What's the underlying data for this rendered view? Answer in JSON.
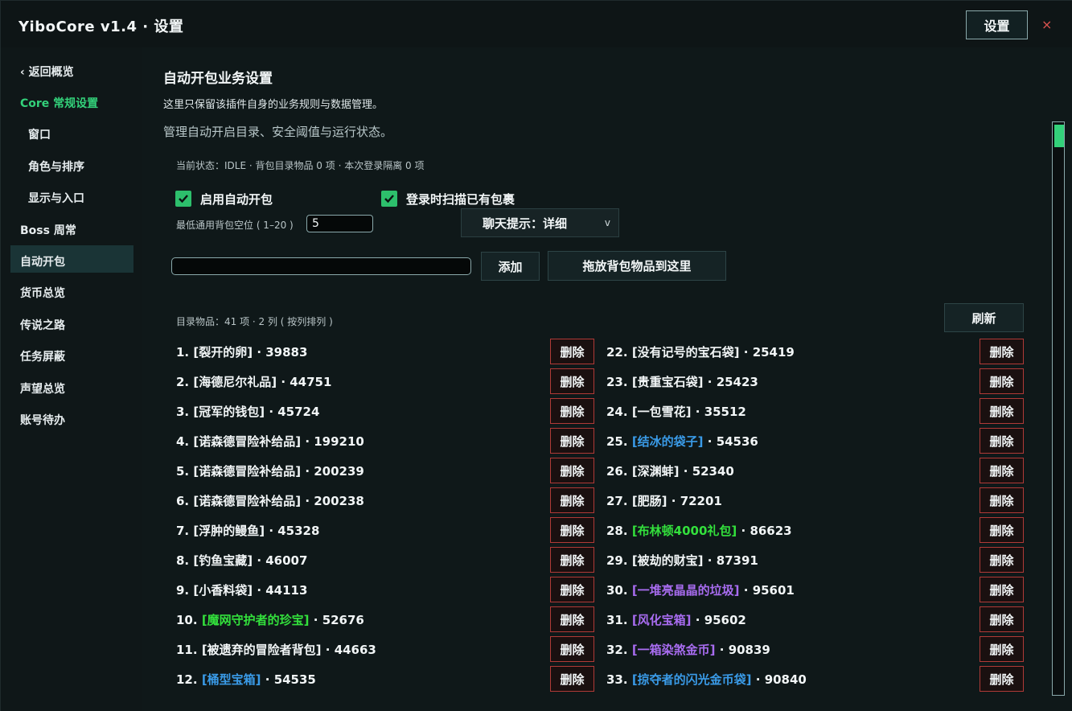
{
  "titlebar": {
    "title": "YiboCore v1.4 · 设置",
    "settings_label": "设置",
    "close_glyph": "×"
  },
  "sidebar": {
    "back": "‹ 返回概览",
    "core": "Core 常规设置",
    "items": [
      "窗口",
      "角色与排序",
      "显示与入口",
      "Boss 周常",
      "自动开包",
      "货币总览",
      "传说之路",
      "任务屏蔽",
      "声望总览",
      "账号待办"
    ],
    "active_index": 4
  },
  "main": {
    "title": "自动开包业务设置",
    "subtitle": "这里只保留该插件自身的业务规则与数据管理。",
    "description": "管理自动开启目录、安全阈值与运行状态。",
    "status": "当前状态：IDLE · 背包目录物品 0 项 · 本次登录隔离 0 项",
    "checkbox_auto": "启用自动开包",
    "checkbox_scan": "登录时扫描已有包裹",
    "min_slots_label": "最低通用背包空位 ( 1–20 )",
    "min_slots_value": "5",
    "chat_select": "聊天提示：详细",
    "chat_chevron": "v",
    "add_label": "添加",
    "drop_label": "拖放背包物品到这里",
    "list_info": "目录物品：41 项 · 2 列 ( 按列排列 )",
    "refresh_label": "刷新",
    "delete_label": "删除"
  },
  "list": {
    "left": [
      {
        "num": "1.",
        "name": "[裂开的卵]",
        "id": "39883",
        "quality": "common"
      },
      {
        "num": "2.",
        "name": "[海德尼尔礼品]",
        "id": "44751",
        "quality": "common"
      },
      {
        "num": "3.",
        "name": "[冠军的钱包]",
        "id": "45724",
        "quality": "common"
      },
      {
        "num": "4.",
        "name": "[诺森德冒险补给品]",
        "id": "199210",
        "quality": "common"
      },
      {
        "num": "5.",
        "name": "[诺森德冒险补给品]",
        "id": "200239",
        "quality": "common"
      },
      {
        "num": "6.",
        "name": "[诺森德冒险补给品]",
        "id": "200238",
        "quality": "common"
      },
      {
        "num": "7.",
        "name": "[浮肿的鳗鱼]",
        "id": "45328",
        "quality": "common"
      },
      {
        "num": "8.",
        "name": "[钓鱼宝藏]",
        "id": "46007",
        "quality": "common"
      },
      {
        "num": "9.",
        "name": "[小香料袋]",
        "id": "44113",
        "quality": "common"
      },
      {
        "num": "10.",
        "name": "[魔网守护者的珍宝]",
        "id": "52676",
        "quality": "green"
      },
      {
        "num": "11.",
        "name": "[被遗弃的冒险者背包]",
        "id": "44663",
        "quality": "common"
      },
      {
        "num": "12.",
        "name": "[桶型宝箱]",
        "id": "54535",
        "quality": "blue"
      }
    ],
    "right": [
      {
        "num": "22.",
        "name": "[没有记号的宝石袋]",
        "id": "25419",
        "quality": "common"
      },
      {
        "num": "23.",
        "name": "[贵重宝石袋]",
        "id": "25423",
        "quality": "common"
      },
      {
        "num": "24.",
        "name": "[一包雪花]",
        "id": "35512",
        "quality": "common"
      },
      {
        "num": "25.",
        "name": "[结冰的袋子]",
        "id": "54536",
        "quality": "blue"
      },
      {
        "num": "26.",
        "name": "[深渊蚌]",
        "id": "52340",
        "quality": "common"
      },
      {
        "num": "27.",
        "name": "[肥肠]",
        "id": "72201",
        "quality": "common"
      },
      {
        "num": "28.",
        "name": "[布林顿4000礼包]",
        "id": "86623",
        "quality": "green"
      },
      {
        "num": "29.",
        "name": "[被劫的财宝]",
        "id": "87391",
        "quality": "common"
      },
      {
        "num": "30.",
        "name": "[一堆亮晶晶的垃圾]",
        "id": "95601",
        "quality": "purple"
      },
      {
        "num": "31.",
        "name": "[风化宝箱]",
        "id": "95602",
        "quality": "purple"
      },
      {
        "num": "32.",
        "name": "[一箱染煞金币]",
        "id": "90839",
        "quality": "purple"
      },
      {
        "num": "33.",
        "name": "[掠夺者的闪光金币袋]",
        "id": "90840",
        "quality": "blue"
      }
    ]
  },
  "colors": {
    "accent_green": "#33d17a",
    "quality_blue": "#3a9be8",
    "quality_green": "#33e03c",
    "quality_purple": "#a86cf0",
    "delete_border": "#b03a37"
  }
}
